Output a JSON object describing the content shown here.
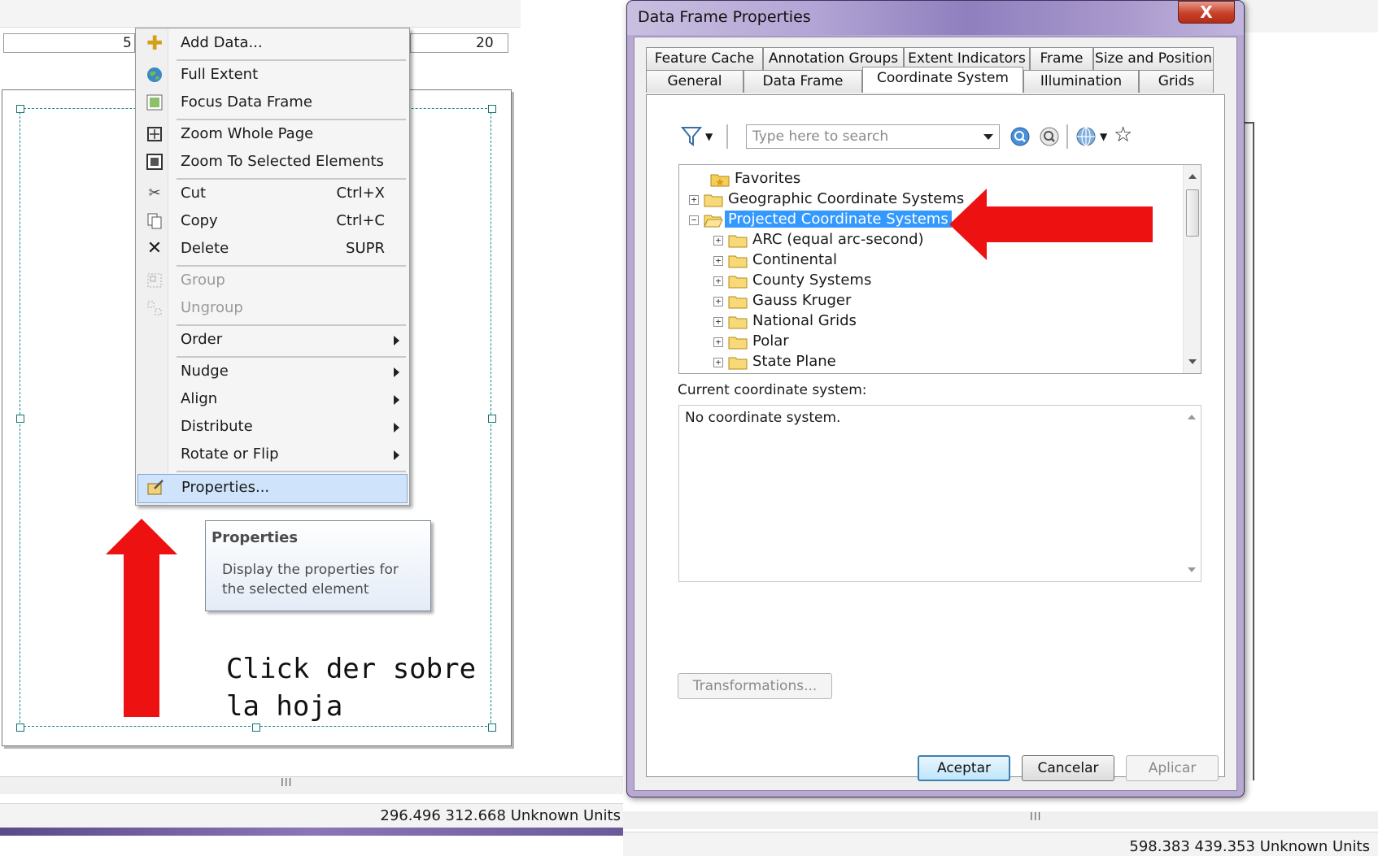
{
  "layout_view": {
    "ruler_left_value": "5",
    "ruler_right_value": "20",
    "status_coords": "296.496  312.668 Unknown Units",
    "scroll_grip": "III"
  },
  "context_menu": {
    "items": [
      {
        "label": "Add Data...",
        "shortcut": "",
        "icon": "add-data-icon"
      },
      {
        "label": "Full Extent",
        "shortcut": "",
        "icon": "globe-icon"
      },
      {
        "label": "Focus Data Frame",
        "shortcut": "",
        "icon": "focus-frame-icon"
      },
      {
        "label": "Zoom Whole Page",
        "shortcut": "",
        "icon": "zoom-page-icon"
      },
      {
        "label": "Zoom To Selected Elements",
        "shortcut": "",
        "icon": "zoom-selected-icon"
      },
      {
        "label": "Cut",
        "shortcut": "Ctrl+X",
        "icon": "scissors-icon"
      },
      {
        "label": "Copy",
        "shortcut": "Ctrl+C",
        "icon": "copy-icon"
      },
      {
        "label": "Delete",
        "shortcut": "SUPR",
        "icon": "delete-x-icon"
      },
      {
        "label": "Group",
        "shortcut": "",
        "icon": "group-icon"
      },
      {
        "label": "Ungroup",
        "shortcut": "",
        "icon": "ungroup-icon"
      },
      {
        "label": "Order",
        "shortcut": "",
        "icon": ""
      },
      {
        "label": "Nudge",
        "shortcut": "",
        "icon": ""
      },
      {
        "label": "Align",
        "shortcut": "",
        "icon": ""
      },
      {
        "label": "Distribute",
        "shortcut": "",
        "icon": ""
      },
      {
        "label": "Rotate or Flip",
        "shortcut": "",
        "icon": ""
      },
      {
        "label": "Properties...",
        "shortcut": "",
        "icon": "properties-icon"
      }
    ]
  },
  "tooltip": {
    "title": "Properties",
    "body": "Display the properties for the selected element"
  },
  "annotation_note": "Click der sobre la hoja",
  "dialog": {
    "title": "Data Frame Properties",
    "close_label": "X",
    "tabs_row1": [
      "Feature Cache",
      "Annotation Groups",
      "Extent Indicators",
      "Frame",
      "Size and Position"
    ],
    "tabs_row2": [
      "General",
      "Data Frame",
      "Coordinate System",
      "Illumination",
      "Grids"
    ],
    "search_placeholder": "Type here to search",
    "tree": [
      {
        "label": "Favorites",
        "level": 0
      },
      {
        "label": "Geographic Coordinate Systems",
        "level": 0
      },
      {
        "label": "Projected Coordinate Systems",
        "level": 0
      },
      {
        "label": "ARC (equal arc-second)",
        "level": 1
      },
      {
        "label": "Continental",
        "level": 1
      },
      {
        "label": "County Systems",
        "level": 1
      },
      {
        "label": "Gauss Kruger",
        "level": 1
      },
      {
        "label": "National Grids",
        "level": 1
      },
      {
        "label": "Polar",
        "level": 1
      },
      {
        "label": "State Plane",
        "level": 1
      }
    ],
    "current_label": "Current coordinate system:",
    "current_value": "No coordinate system.",
    "transformations_label": "Transformations...",
    "ok_label": "Aceptar",
    "cancel_label": "Cancelar",
    "apply_label": "Aplicar"
  },
  "right_view": {
    "status_coords": "598.383  439.353 Unknown Units",
    "scroll_grip": "III"
  },
  "colors": {
    "selection_blue": "#3399ff",
    "annotation_red": "#ee1111",
    "frame_teal": "#1d8a8a"
  }
}
